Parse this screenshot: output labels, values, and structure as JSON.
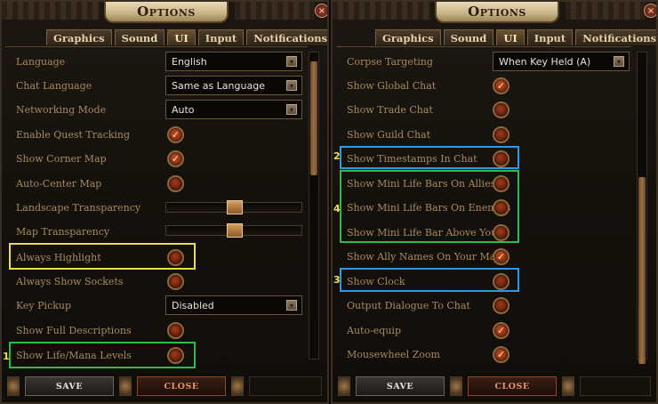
{
  "header": {
    "title": "Options",
    "close_symbol": "×"
  },
  "tabs": [
    "Graphics",
    "Sound",
    "UI",
    "Input",
    "Notifications"
  ],
  "active_tab": "UI",
  "left_settings": [
    {
      "label": "Language",
      "control": "select",
      "value": "English"
    },
    {
      "label": "Chat Language",
      "control": "select",
      "value": "Same as Language"
    },
    {
      "label": "Networking Mode",
      "control": "select",
      "value": "Auto"
    },
    {
      "label": "Enable Quest Tracking",
      "control": "toggle",
      "checked": true
    },
    {
      "label": "Show Corner Map",
      "control": "toggle",
      "checked": true
    },
    {
      "label": "Auto-Center Map",
      "control": "toggle",
      "checked": false
    },
    {
      "label": "Landscape Transparency",
      "control": "slider",
      "level": 0.5
    },
    {
      "label": "Map Transparency",
      "control": "slider",
      "level": 0.5
    },
    {
      "label": "Always Highlight",
      "control": "toggle",
      "checked": false
    },
    {
      "label": "Always Show Sockets",
      "control": "toggle",
      "checked": false
    },
    {
      "label": "Key Pickup",
      "control": "select",
      "value": "Disabled"
    },
    {
      "label": "Show Full Descriptions",
      "control": "toggle",
      "checked": false
    },
    {
      "label": "Show Life/Mana Levels",
      "control": "toggle",
      "checked": false
    }
  ],
  "right_settings": [
    {
      "label": "Corpse Targeting",
      "control": "select",
      "value": "When Key Held (A)"
    },
    {
      "label": "Show Global Chat",
      "control": "toggle",
      "checked": true
    },
    {
      "label": "Show Trade Chat",
      "control": "toggle",
      "checked": false
    },
    {
      "label": "Show Guild Chat",
      "control": "toggle",
      "checked": false
    },
    {
      "label": "Show Timestamps In Chat",
      "control": "toggle",
      "checked": false
    },
    {
      "label": "Show Mini Life Bars On Allies",
      "control": "toggle",
      "checked": false
    },
    {
      "label": "Show Mini Life Bars On Enemies",
      "control": "toggle",
      "checked": false
    },
    {
      "label": "Show Mini Life Bar Above You",
      "control": "toggle",
      "checked": false
    },
    {
      "label": "Show Ally Names On Your Map",
      "control": "toggle",
      "checked": true
    },
    {
      "label": "Show Clock",
      "control": "toggle",
      "checked": false
    },
    {
      "label": "Output Dialogue To Chat",
      "control": "toggle",
      "checked": false
    },
    {
      "label": "Auto-equip",
      "control": "toggle",
      "checked": true
    },
    {
      "label": "Mousewheel Zoom",
      "control": "toggle",
      "checked": true
    }
  ],
  "footer": {
    "save_label": "SAVE",
    "close_label": "CLOSE"
  },
  "annotations": {
    "a1": "1",
    "a2": "2",
    "a3": "3",
    "a4": "4"
  },
  "check_symbol": "✓",
  "dropdown_symbol": "▾",
  "colors": {
    "highlight_yellow": "#e8e04a",
    "highlight_green": "#2fbb4a",
    "highlight_blue": "#2a9ae8",
    "label_text": "#a88a5c",
    "toggle_red": "#a23a1c"
  }
}
